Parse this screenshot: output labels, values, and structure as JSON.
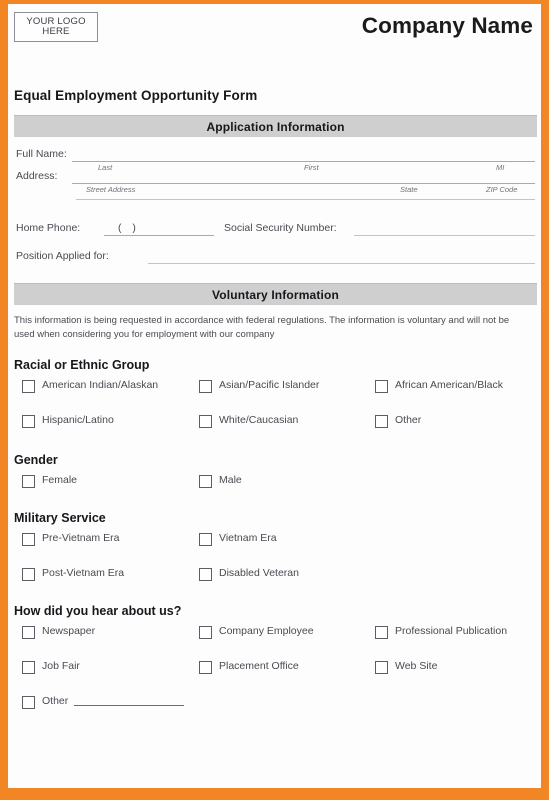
{
  "header": {
    "logo_line1": "YOUR LOGO",
    "logo_line2": "HERE",
    "company_name": "Company Name"
  },
  "form_title": "Equal Employment Opportunity Form",
  "sections": {
    "application": {
      "bar_title": "Application Information",
      "fields": {
        "full_name_label": "Full Name:",
        "full_name_sub_last": "Last",
        "full_name_sub_first": "First",
        "full_name_sub_mi": "MI",
        "address_label": "Address:",
        "address_sub_street": "Street Address",
        "address_sub_state": "State",
        "address_sub_zip": "ZIP Code",
        "home_phone_label": "Home Phone:",
        "home_phone_value": "(        )",
        "ssn_label": "Social Security Number:",
        "position_label": "Position Applied for:"
      }
    },
    "voluntary": {
      "bar_title": "Voluntary Information",
      "disclaimer": "This information is being requested in accordance with federal regulations.  The information is voluntary and will not be used when considering you for employment with our company"
    },
    "racial": {
      "heading": "Racial or Ethnic Group",
      "options": [
        "American Indian/Alaskan",
        "Asian/Pacific Islander",
        "African American/Black",
        "Hispanic/Latino",
        "White/Caucasian",
        "Other"
      ]
    },
    "gender": {
      "heading": "Gender",
      "options": [
        "Female",
        "Male"
      ]
    },
    "military": {
      "heading": "Military Service",
      "options": [
        "Pre-Vietnam Era",
        "Vietnam Era",
        "Post-Vietnam Era",
        "Disabled Veteran"
      ]
    },
    "referral": {
      "heading": "How did you hear about us?",
      "options": [
        "Newspaper",
        "Company Employee",
        "Professional Publication",
        "Job Fair",
        "Placement Office",
        "Web Site",
        "Other"
      ]
    }
  },
  "colors": {
    "border_orange": "#f28524",
    "section_bar_gray": "#cfcfcf",
    "page_white": "#fdfdfd"
  }
}
